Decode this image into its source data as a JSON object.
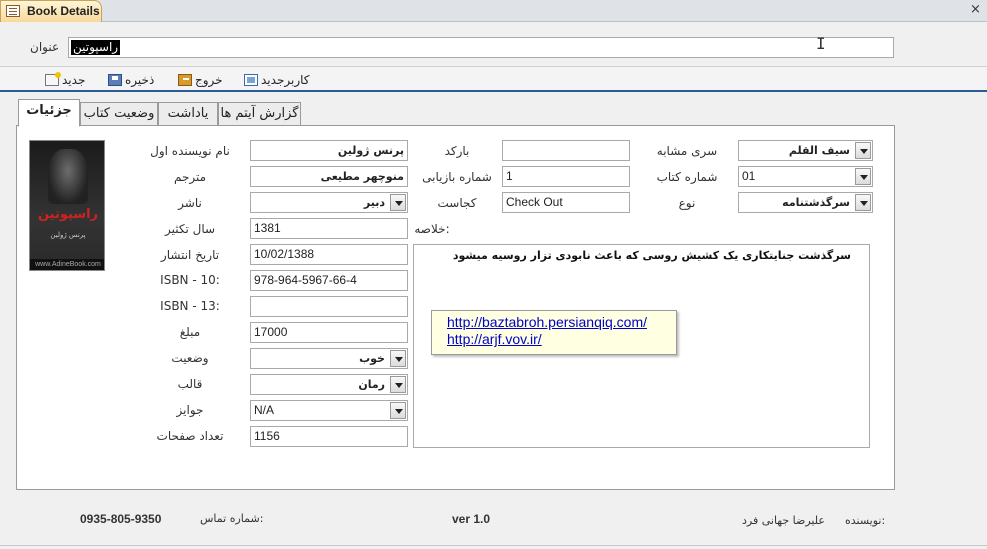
{
  "window": {
    "tab_title": "Book Details",
    "close_glyph": "×"
  },
  "header": {
    "title_label": "عنوان",
    "title_value": "راسپوتین"
  },
  "toolbar": {
    "new_label": "جدید",
    "save_label": "ذخیره",
    "exit_label": "خروج",
    "new_user_label": "کاربرجدید"
  },
  "tabs": [
    {
      "label": "جزئیات",
      "active": true
    },
    {
      "label": "وضعیت کتاب",
      "active": false
    },
    {
      "label": "یاداشت",
      "active": false
    },
    {
      "label": "گزارش آیتم ها",
      "active": false
    }
  ],
  "cover": {
    "title": "راسپوتین",
    "author": "پرنس ژولین",
    "footer": "www.AdineBook.com"
  },
  "left_fields": {
    "author_first": {
      "label": "نام نویسنده اول",
      "value": "پرنس ژولین"
    },
    "translator": {
      "label": "مترجم",
      "value": "منوچهر مطیعی"
    },
    "publisher": {
      "label": "ناشر",
      "value": "دبیر"
    },
    "reprint_year": {
      "label": "سال تکثیر",
      "value": "1381"
    },
    "publish_date": {
      "label": "تاریخ انتشار",
      "value": "10/02/1388"
    },
    "isbn10": {
      "label": "ISBN - 10:",
      "value": "978-964-5967-66-4"
    },
    "isbn13": {
      "label": "ISBN - 13:",
      "value": ""
    },
    "price": {
      "label": "مبلغ",
      "value": "17000"
    },
    "condition": {
      "label": "وضعیت",
      "value": "خوب"
    },
    "format": {
      "label": "قالب",
      "value": "رمان"
    },
    "awards": {
      "label": "جوایز",
      "value": "N/A"
    },
    "pages": {
      "label": "تعداد صفحات",
      "value": "1156"
    }
  },
  "middle_fields": {
    "barcode": {
      "label": "بارکد",
      "value": ""
    },
    "retrieval_number": {
      "label": "شماره بازیابی",
      "value": "1"
    },
    "location": {
      "label": "کجاست",
      "value": "Check Out"
    },
    "summary_label": "خلاصه:"
  },
  "right_fields": {
    "series": {
      "label": "سری مشابه",
      "value": "سیف القلم"
    },
    "book_number": {
      "label": "شماره کتاب",
      "value": "01"
    },
    "genre": {
      "label": "نوع",
      "value": "سرگذشتنامه"
    }
  },
  "summary_text": "سرگذشت جنایتکاری یک کشیش روسی که باعث نابودی تزار روسیه میشود",
  "tooltip_links": [
    "http://baztabroh.persianqiq.com/",
    "http://arjf.vov.ir/"
  ],
  "footer": {
    "phone": "0935-805-9350",
    "phone_label": "شماره تماس:",
    "version": "ver 1.0",
    "author_label": "نویسنده:",
    "author_name": "علیرضا جهانی فرد"
  }
}
